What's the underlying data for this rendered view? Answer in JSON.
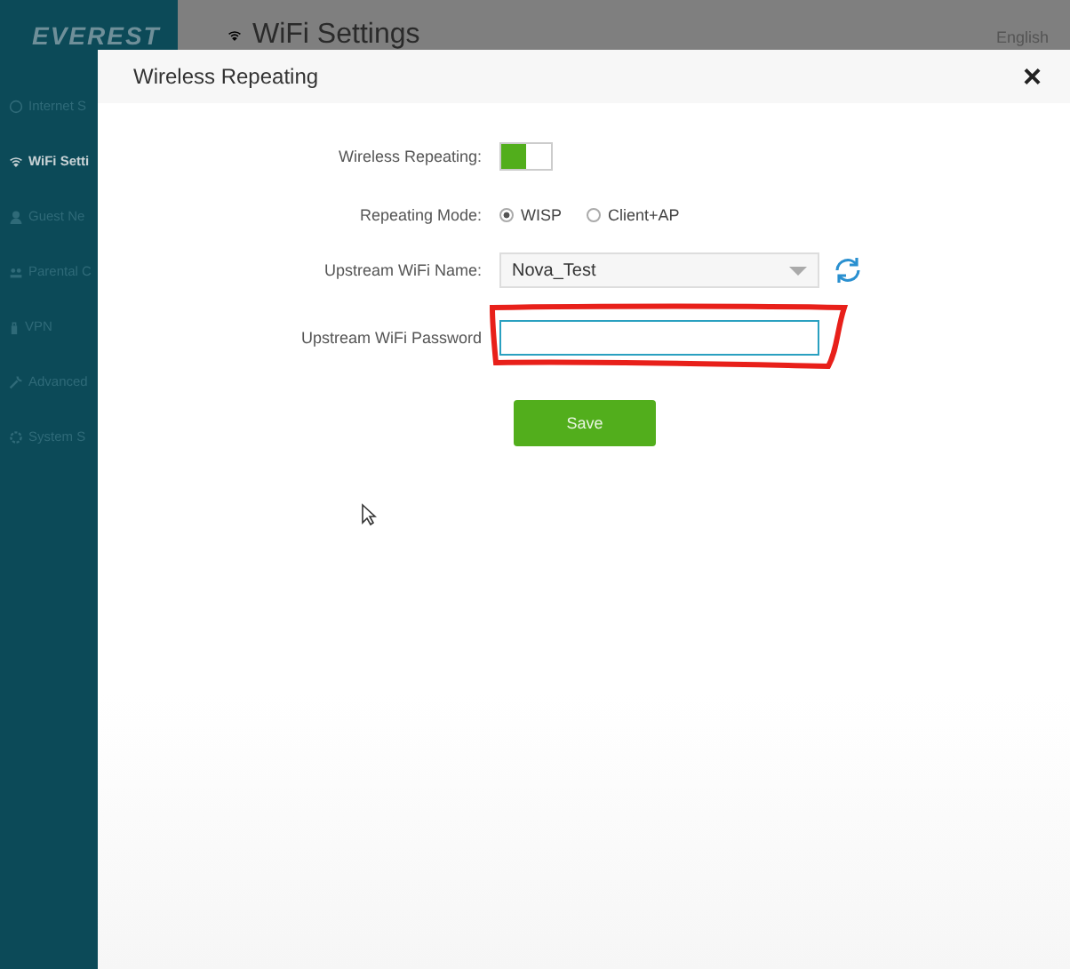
{
  "header": {
    "logo": "EVEREST",
    "title": "WiFi Settings",
    "language": "English"
  },
  "sidebar": {
    "items": [
      {
        "label": "Internet S",
        "selected": false
      },
      {
        "label": "WiFi Setti",
        "selected": true
      },
      {
        "label": "Guest Ne",
        "selected": false
      },
      {
        "label": "Parental C",
        "selected": false
      },
      {
        "label": "VPN",
        "selected": false
      },
      {
        "label": "Advanced",
        "selected": false
      },
      {
        "label": "System S",
        "selected": false
      }
    ]
  },
  "dialog": {
    "title": "Wireless Repeating",
    "close": "×",
    "fields": [
      {
        "kind": "toggle",
        "label": "Wireless Repeating:",
        "on": true
      },
      {
        "kind": "radio",
        "label": "Repeating Mode:",
        "options": [
          {
            "label": "WISP",
            "selected": true
          },
          {
            "label": "Client+AP",
            "selected": false
          }
        ]
      },
      {
        "kind": "select",
        "label": "Upstream WiFi Name:",
        "value": "Nova_Test"
      },
      {
        "kind": "password",
        "label": "Upstream WiFi Password",
        "focused": true,
        "highlighted": true
      }
    ],
    "save": "Save"
  }
}
